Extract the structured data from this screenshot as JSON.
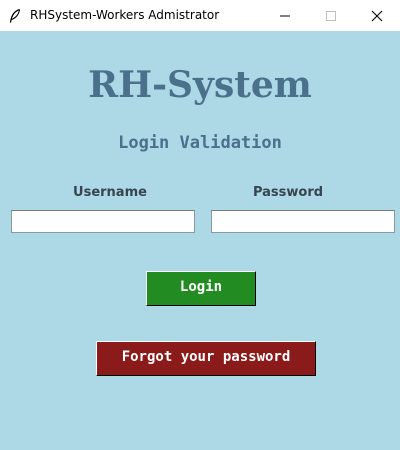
{
  "window": {
    "title": "RHSystem-Workers Admistrator",
    "icon": "feather-icon"
  },
  "colors": {
    "background": "#add8e6",
    "heading": "#4a708b",
    "login_button": "#228b22",
    "forgot_button": "#8b1a1a"
  },
  "main": {
    "heading": "RH-System",
    "subheading": "Login Validation",
    "username_label": "Username",
    "password_label": "Password",
    "username_value": "",
    "password_value": "",
    "login_label": "Login",
    "forgot_label": "Forgot your password"
  }
}
